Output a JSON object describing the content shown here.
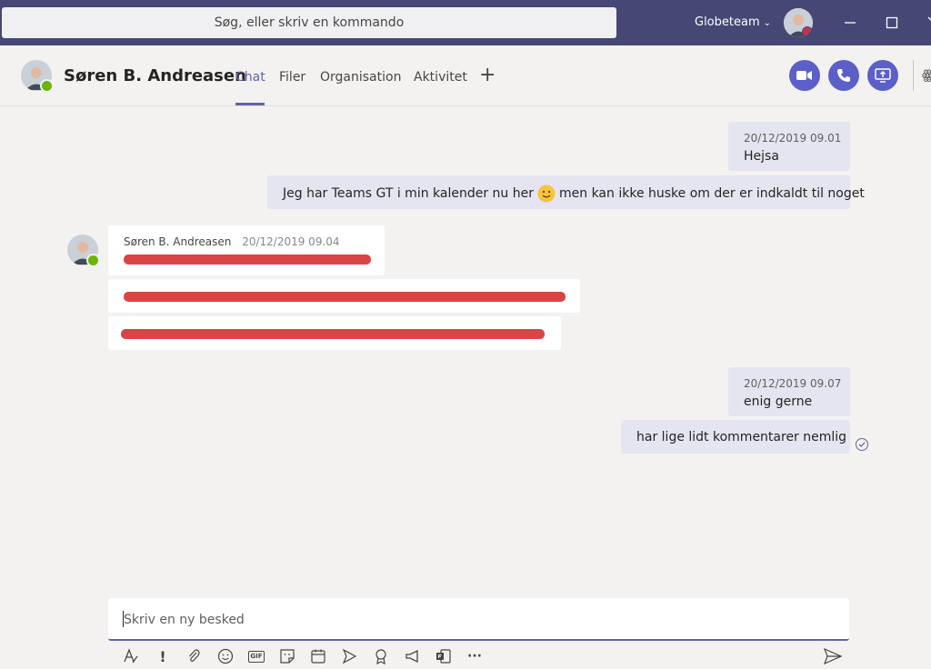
{
  "topbar": {
    "search_placeholder": "Søg, eller skriv en kommando",
    "org_name": "Globeteam"
  },
  "header": {
    "contact_name": "Søren B. Andreasen",
    "tabs": [
      {
        "label": "Chat",
        "active": true
      },
      {
        "label": "Filer"
      },
      {
        "label": "Organisation"
      },
      {
        "label": "Aktivitet"
      }
    ]
  },
  "messages": {
    "m1": {
      "time": "20/12/2019 09.01",
      "text": "Hejsa"
    },
    "m2": {
      "text_before": "Jeg har Teams GT i min kalender nu her",
      "text_after": "men kan ikke huske om der er indkaldt til noget"
    },
    "m3": {
      "sender": "Søren B. Andreasen",
      "time": "20/12/2019 09.04"
    },
    "m4": {
      "time": "20/12/2019 09.07",
      "text": "enig gerne"
    },
    "m5": {
      "text": "har lige lidt kommentarer nemlig"
    }
  },
  "compose": {
    "placeholder": "Skriv en ny besked"
  },
  "colors": {
    "titlebar": "#464775",
    "accent": "#6264a7",
    "own_bubble": "#e5e5f1",
    "redaction": "#d93a3a",
    "available": "#6bb700"
  }
}
